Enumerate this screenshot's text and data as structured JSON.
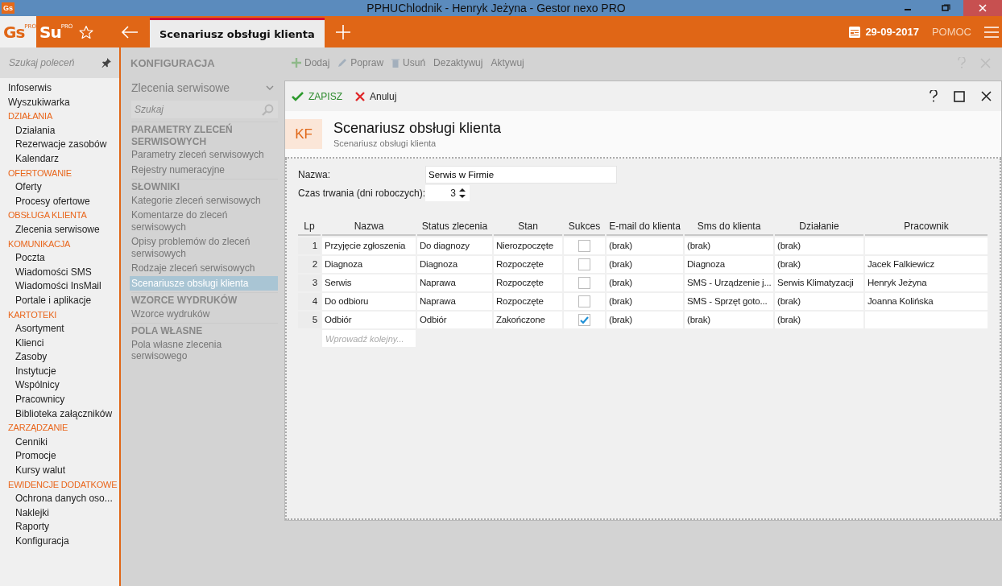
{
  "window": {
    "app_icon": "Gs",
    "title": "PPHUChlodnik - Henryk Jeżyna - Gestor nexo PRO"
  },
  "topbar": {
    "apps": [
      {
        "text": "Gs",
        "badge": "PRO",
        "selected": true
      },
      {
        "text": "Su",
        "badge": "PRO",
        "selected": false
      }
    ],
    "tabs": [
      {
        "label": "Scenariusz obsługi klienta",
        "selected": true
      }
    ],
    "date": "29-09-2017",
    "help": "POMOC"
  },
  "sidebar": {
    "search_placeholder": "Szukaj poleceń",
    "items": [
      {
        "label": "Infoserwis"
      },
      {
        "label": "Wyszukiwarka"
      },
      {
        "label": "DZIAŁANIA",
        "children": [
          {
            "label": "Działania"
          },
          {
            "label": "Rezerwacje zasobów"
          },
          {
            "label": "Kalendarz"
          }
        ]
      },
      {
        "label": "OFERTOWANIE",
        "children": [
          {
            "label": "Oferty"
          },
          {
            "label": "Procesy ofertowe"
          }
        ]
      },
      {
        "label": "OBSŁUGA KLIENTA",
        "children": [
          {
            "label": "Zlecenia serwisowe"
          }
        ]
      },
      {
        "label": "KOMUNIKACJA",
        "children": [
          {
            "label": "Poczta"
          },
          {
            "label": "Wiadomości SMS"
          },
          {
            "label": "Wiadomości InsMail"
          },
          {
            "label": "Portale i aplikacje"
          }
        ]
      },
      {
        "label": "KARTOTEKI",
        "children": [
          {
            "label": "Asortyment"
          },
          {
            "label": "Klienci"
          },
          {
            "label": "Zasoby"
          },
          {
            "label": "Instytucje"
          },
          {
            "label": "Wspólnicy"
          },
          {
            "label": "Pracownicy"
          },
          {
            "label": "Biblioteka załączników"
          }
        ]
      },
      {
        "label": "ZARZĄDZANIE",
        "children": [
          {
            "label": "Cenniki"
          },
          {
            "label": "Promocje"
          },
          {
            "label": "Kursy walut"
          }
        ]
      },
      {
        "label": "EWIDENCJE DODATKOWE",
        "children": [
          {
            "label": "Ochrona danych oso..."
          },
          {
            "label": "Naklejki"
          },
          {
            "label": "Raporty"
          },
          {
            "label": "Konfiguracja"
          }
        ]
      }
    ]
  },
  "config": {
    "title": "KONFIGURACJA",
    "module": "Zlecenia serwisowe",
    "search_placeholder": "Szukaj",
    "groups": [
      {
        "title": "PARAMETRY ZLECEŃ SERWISOWYCH",
        "items": [
          {
            "label": "Parametry zleceń serwisowych",
            "selected": false
          },
          {
            "label": "Rejestry numeracyjne",
            "selected": false
          }
        ]
      },
      {
        "title": "SŁOWNIKI",
        "items": [
          {
            "label": "Kategorie zleceń serwisowych",
            "selected": false
          },
          {
            "label": "Komentarze do zleceń serwisowych",
            "selected": false
          },
          {
            "label": "Opisy problemów do zleceń serwisowych",
            "selected": false
          },
          {
            "label": "Rodzaje zleceń serwisowych",
            "selected": false
          },
          {
            "label": "Scenariusze obsługi klienta",
            "selected": true
          }
        ]
      },
      {
        "title": "WZORCE WYDRUKÓW",
        "items": [
          {
            "label": "Wzorce wydruków",
            "selected": false
          }
        ]
      },
      {
        "title": "POLA WŁASNE",
        "items": [
          {
            "label": "Pola własne zlecenia serwisowego",
            "selected": false
          }
        ]
      }
    ]
  },
  "toolbar": {
    "actions": [
      {
        "label": "Dodaj",
        "disabled": true
      },
      {
        "label": "Popraw",
        "disabled": true
      },
      {
        "label": "Usuń",
        "disabled": true
      },
      {
        "label": "Dezaktywuj",
        "disabled": true
      },
      {
        "label": "Aktywuj",
        "disabled": true
      }
    ]
  },
  "dialog": {
    "save": "ZAPISZ",
    "cancel": "Anuluj",
    "badge": "KF",
    "title": "Scenariusz obsługi klienta",
    "subtitle": "Scenariusz obsługi klienta",
    "name_label": "Nazwa:",
    "name_value": "Serwis w Firmie",
    "duration_label": "Czas trwania (dni roboczych):",
    "duration_value": "3",
    "table": {
      "columns": [
        "Lp",
        "Nazwa",
        "Status zlecenia",
        "Stan",
        "Sukces",
        "E-mail do klienta",
        "Sms do klienta",
        "Działanie",
        "Pracownik"
      ],
      "rows": [
        {
          "lp": "1",
          "name": "Przyjęcie zgłoszenia",
          "status": "Do diagnozy",
          "state": "Nierozpoczęte",
          "success": false,
          "email": "(brak)",
          "sms": "(brak)",
          "action": "(brak)",
          "employee": ""
        },
        {
          "lp": "2",
          "name": "Diagnoza",
          "status": "Diagnoza",
          "state": "Rozpoczęte",
          "success": false,
          "email": "(brak)",
          "sms": "Diagnoza",
          "action": "(brak)",
          "employee": "Jacek Falkiewicz"
        },
        {
          "lp": "3",
          "name": "Serwis",
          "status": "Naprawa",
          "state": "Rozpoczęte",
          "success": false,
          "email": "(brak)",
          "sms": "SMS - Urządzenie j...",
          "action": "Serwis Klimatyzacji",
          "employee": "Henryk Jeżyna"
        },
        {
          "lp": "4",
          "name": "Do odbioru",
          "status": "Naprawa",
          "state": "Rozpoczęte",
          "success": false,
          "email": "(brak)",
          "sms": "SMS - Sprzęt goto...",
          "action": "(brak)",
          "employee": "Joanna Kolińska"
        },
        {
          "lp": "5",
          "name": "Odbiór",
          "status": "Odbiór",
          "state": "Zakończone",
          "success": true,
          "email": "(brak)",
          "sms": "(brak)",
          "action": "(brak)",
          "employee": ""
        }
      ],
      "new_row_placeholder": "Wprowadź kolejny..."
    }
  }
}
